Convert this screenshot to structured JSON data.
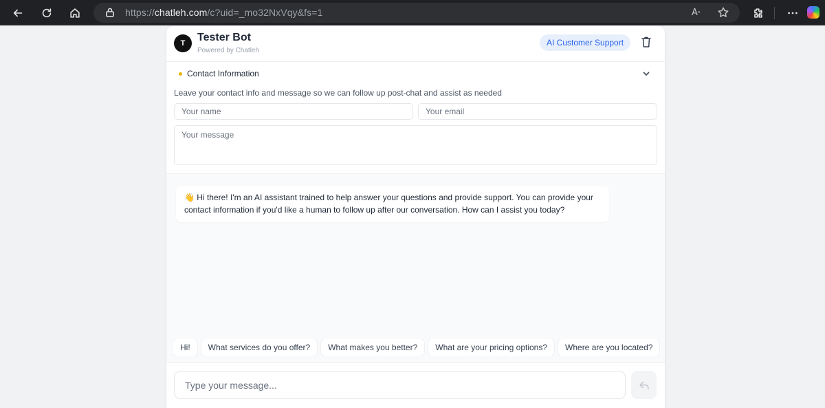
{
  "browser": {
    "url_scheme": "https://",
    "url_host": "chatleh.com",
    "url_path": "/c?uid=_mo32NxVqy&fs=1",
    "read_aloud_label": "A",
    "icons": [
      "back-arrow-icon",
      "refresh-icon",
      "home-icon",
      "lock-icon",
      "read-aloud-icon",
      "favorite-star-icon",
      "extensions-icon",
      "more-icon",
      "copilot-icon"
    ]
  },
  "header": {
    "avatar_initial": "T",
    "bot_name": "Tester Bot",
    "powered_by": "Powered by Chatleh",
    "badge": "AI Customer Support"
  },
  "contact": {
    "title": "Contact Information",
    "description": "Leave your contact info and message so we can follow up post-chat and assist as needed",
    "name_placeholder": "Your name",
    "email_placeholder": "Your email",
    "message_placeholder": "Your message"
  },
  "conversation": {
    "greeting": "👋 Hi there! I'm an AI assistant trained to help answer your questions and provide support. You can provide your contact information if you'd like a human to follow up after our conversation. How can I assist you today?"
  },
  "suggestions": [
    "Hi!",
    "What services do you offer?",
    "What makes you better?",
    "What are your pricing options?",
    "Where are you located?"
  ],
  "composer": {
    "placeholder": "Type your message..."
  },
  "colors": {
    "badge_bg": "#e8effc",
    "badge_text": "#2563eb",
    "status_dot": "#eab308",
    "browser_toolbar": "#202124"
  }
}
